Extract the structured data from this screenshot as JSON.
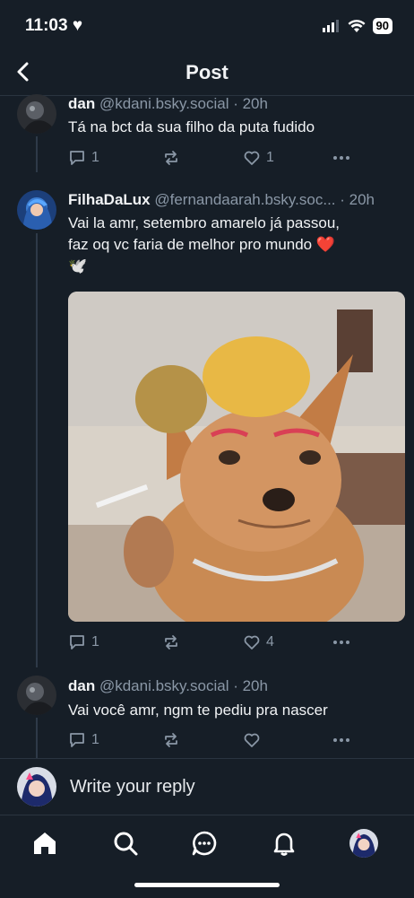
{
  "status": {
    "time": "11:03",
    "battery": "90"
  },
  "header": {
    "title": "Post"
  },
  "posts": [
    {
      "name": "dan",
      "handle": "@kdani.bsky.social",
      "time": "· 20h",
      "text": "Tá na bct da sua filho da puta fudido",
      "replies": "1",
      "likes": "1"
    },
    {
      "name": "FilhaDaLux",
      "handle": "@fernandaarah.bsky.soc...",
      "time": "· 20h",
      "text_line1": "Vai la amr, setembro amarelo já passou,",
      "text_line2": "faz oq vc faria de melhor pro mundo ❤️",
      "text_line3": "🕊️",
      "replies": "1",
      "likes": "4"
    },
    {
      "name": "dan",
      "handle": "@kdani.bsky.social",
      "time": "· 20h",
      "text": "Vai você amr, ngm te pediu pra nascer",
      "replies": "1"
    }
  ],
  "composer": {
    "placeholder": "Write your reply"
  },
  "icons": [
    "back-icon",
    "reply-icon",
    "repost-icon",
    "like-icon",
    "more-icon",
    "home-icon",
    "search-icon",
    "chat-icon",
    "bell-icon",
    "profile-icon"
  ]
}
